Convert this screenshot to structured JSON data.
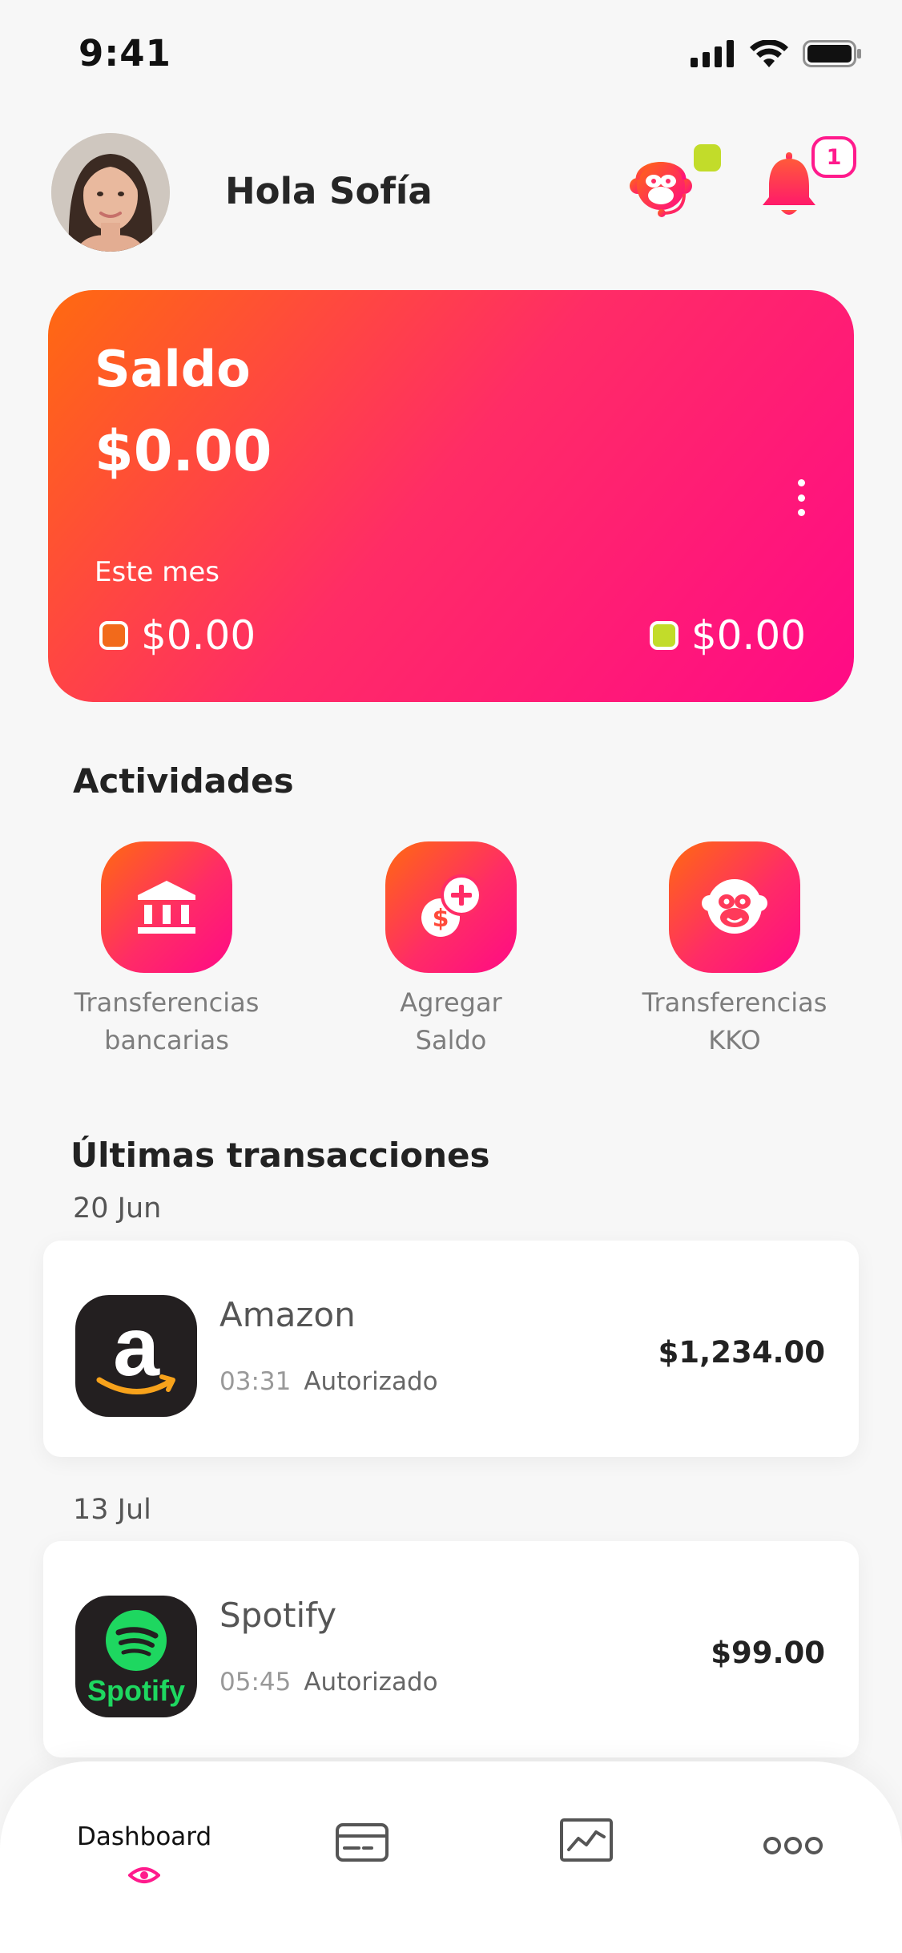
{
  "status_bar": {
    "time": "9:41"
  },
  "header": {
    "greeting": "Hola Sofía",
    "notification_count": "1"
  },
  "balance_card": {
    "title": "Saldo",
    "amount": "$0.00",
    "period_label": "Este mes",
    "left_amount": "$0.00",
    "right_amount": "$0.00",
    "colors": {
      "gradient_start": "#ff6a10",
      "gradient_end": "#ff0a86",
      "left_marker": "#f26a1b",
      "right_marker": "#c2dc2a"
    }
  },
  "activities": {
    "title": "Actividades",
    "items": [
      {
        "label_line1": "Transferencias",
        "label_line2": "bancarias",
        "icon": "bank-icon"
      },
      {
        "label_line1": "Agregar",
        "label_line2": "Saldo",
        "icon": "add-coin-icon"
      },
      {
        "label_line1": "Transferencias",
        "label_line2": "KKO",
        "icon": "monkey-icon"
      }
    ]
  },
  "transactions": {
    "title": "Últimas transacciones",
    "groups": [
      {
        "date": "20 Jun",
        "merchant": "Amazon",
        "time": "03:31",
        "status": "Autorizado",
        "amount": "$1,234.00",
        "icon": "amazon-logo"
      },
      {
        "date": "13 Jul",
        "merchant": "Spotify",
        "time": "05:45",
        "status": "Autorizado",
        "amount": "$99.00",
        "icon": "spotify-logo",
        "logo_text": "Spotify"
      }
    ]
  },
  "tab_bar": {
    "items": [
      {
        "label": "Dashboard",
        "icon": "eye-icon",
        "active": true
      },
      {
        "label": "",
        "icon": "card-icon"
      },
      {
        "label": "",
        "icon": "chart-icon"
      },
      {
        "label": "",
        "icon": "more-icon"
      }
    ],
    "accent": "#ff1a8c"
  }
}
